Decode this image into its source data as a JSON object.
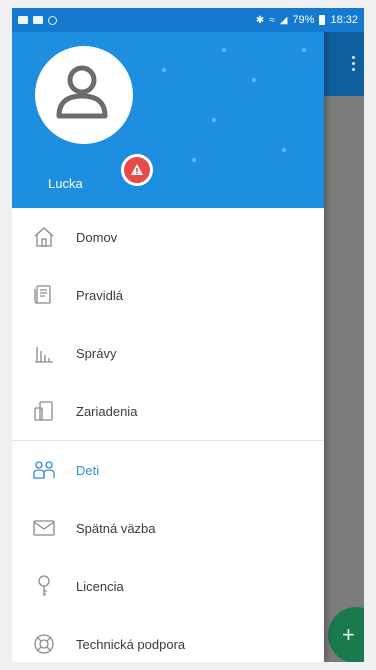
{
  "status_bar": {
    "battery": "79%",
    "time": "18:32"
  },
  "drawer": {
    "user_name": "Lucka",
    "items": [
      {
        "label": "Domov",
        "icon": "home-icon",
        "active": false
      },
      {
        "label": "Pravidlá",
        "icon": "rules-scroll-icon",
        "active": false
      },
      {
        "label": "Správy",
        "icon": "reports-chart-icon",
        "active": false
      },
      {
        "label": "Zariadenia",
        "icon": "devices-icon",
        "active": false
      },
      {
        "label": "Deti",
        "icon": "children-icon",
        "active": true
      },
      {
        "label": "Spätná väzba",
        "icon": "feedback-envelope-icon",
        "active": false
      },
      {
        "label": "Licencia",
        "icon": "license-key-icon",
        "active": false
      },
      {
        "label": "Technická podpora",
        "icon": "support-lifebuoy-icon",
        "active": false
      }
    ]
  },
  "colors": {
    "header_blue": "#1e8ee0",
    "active_blue": "#2d8ee0",
    "warning_red": "#e74a4a",
    "fab_green": "#1b7a4d"
  },
  "fab": {
    "icon": "plus-icon",
    "symbol": "+"
  }
}
